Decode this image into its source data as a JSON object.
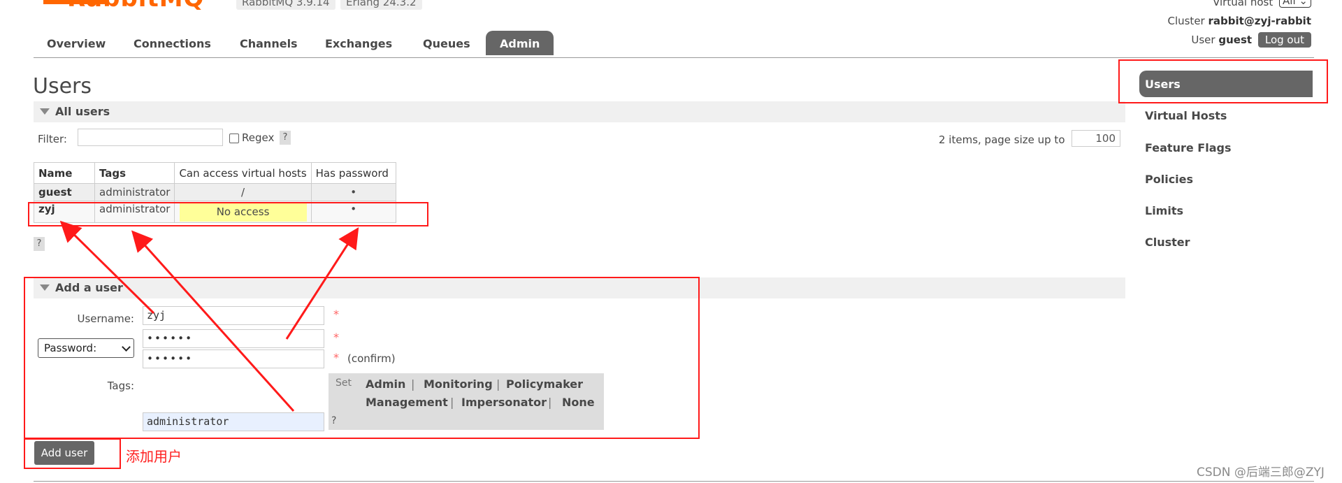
{
  "header": {
    "logo_text": "RabbitMQ™",
    "version_rabbitmq": "RabbitMQ 3.9.14",
    "version_erlang": "Erlang 24.3.2",
    "virtual_host_label": "Virtual host",
    "virtual_host_value": "All",
    "cluster_label": "Cluster",
    "cluster_value": "rabbit@zyj-rabbit",
    "user_label": "User",
    "user_value": "guest",
    "logout_label": "Log out"
  },
  "nav": {
    "tabs": [
      {
        "label": "Overview"
      },
      {
        "label": "Connections"
      },
      {
        "label": "Channels"
      },
      {
        "label": "Exchanges"
      },
      {
        "label": "Queues"
      },
      {
        "label": "Admin",
        "active": true
      }
    ]
  },
  "page": {
    "title": "Users",
    "all_users_section": "All users",
    "filter_label": "Filter:",
    "regex_label": "Regex",
    "help_mark": "?",
    "items_info": "2 items, page size up to",
    "page_size": "100"
  },
  "users_table": {
    "headers": [
      "Name",
      "Tags",
      "Can access virtual hosts",
      "Has password"
    ],
    "rows": [
      {
        "name": "guest",
        "tags": "administrator",
        "vhosts": "/",
        "has_password": "•"
      },
      {
        "name": "zyj",
        "tags": "administrator",
        "vhosts": "No access",
        "has_password": "•"
      }
    ]
  },
  "add_user": {
    "section_title": "Add a user",
    "username_label": "Username:",
    "username_value": "zyj",
    "password_select": "Password:",
    "password_mask": "••••••",
    "confirm_mask": "••••••",
    "required_mark": "*",
    "confirm_note": "(confirm)",
    "tags_label": "Tags:",
    "tags_value": "administrator",
    "set_label": "Set",
    "tag_options": [
      "Admin",
      "Monitoring",
      "Policymaker",
      "Management",
      "Impersonator",
      "None"
    ],
    "separator": "|",
    "submit_label": "Add user"
  },
  "sidebar": {
    "items": [
      {
        "label": "Users",
        "active": true
      },
      {
        "label": "Virtual Hosts"
      },
      {
        "label": "Feature Flags"
      },
      {
        "label": "Policies"
      },
      {
        "label": "Limits"
      },
      {
        "label": "Cluster"
      }
    ]
  },
  "annotation": {
    "add_user_note": "添加用户",
    "highlight_color": "#ff1a1a"
  },
  "watermark": "CSDN @后端三郎@ZYJ",
  "colors": {
    "brand": "#ff6600",
    "active_tab": "#666666",
    "no_access_bg": "#ffff99"
  }
}
